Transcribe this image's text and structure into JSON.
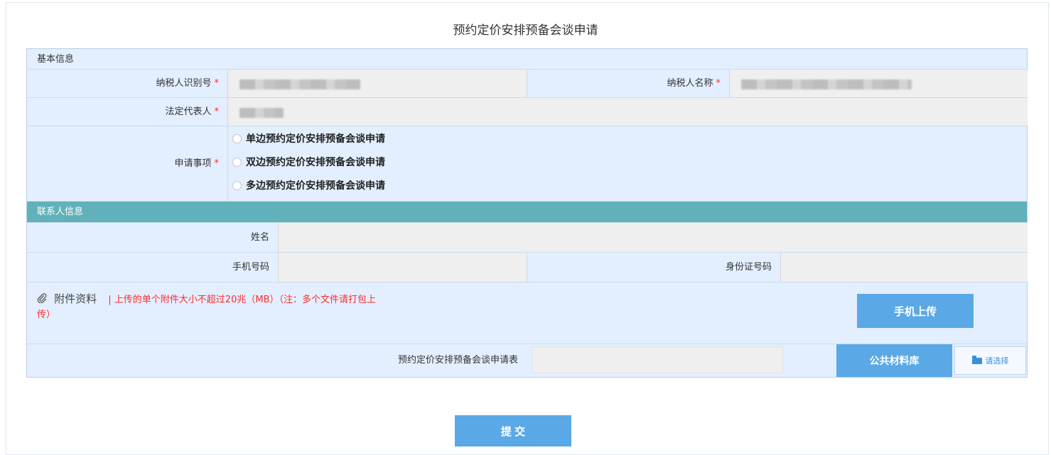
{
  "title": "预约定价安排预备会谈申请",
  "basic": {
    "section_label": "基本信息",
    "taxpayer_id_label": "纳税人识别号",
    "taxpayer_name_label": "纳税人名称",
    "legal_rep_label": "法定代表人",
    "matter_label": "申请事项",
    "required_mark": "*",
    "options": [
      "单边预约定价安排预备会谈申请",
      "双边预约定价安排预备会谈申请",
      "多边预约定价安排预备会谈申请"
    ]
  },
  "contact": {
    "section_label": "联系人信息",
    "name_label": "姓名",
    "phone_label": "手机号码",
    "id_label": "身份证号码"
  },
  "attachment": {
    "label": "附件资料",
    "note_line1": "| 上传的单个附件大小不超过20兆（MB）（注：多个文件请打包上",
    "note_line2": "传）",
    "mobile_upload": "手机上传",
    "file_label": "预约定价安排预备会谈申请表",
    "library_button": "公共材料库",
    "choose_button": "请选择"
  },
  "submit_label": "提 交",
  "colors": {
    "accent": "#5aa9e6",
    "teal": "#61b1bb",
    "required": "#ff2a2a",
    "row_bg": "#e3efff",
    "input_bg": "#efefef"
  },
  "icons": {
    "attachment": "paperclip-icon",
    "choose": "folder-icon"
  }
}
